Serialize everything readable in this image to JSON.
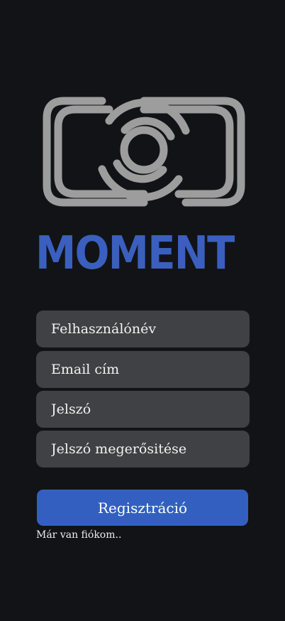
{
  "brand": {
    "title": "MOMENT",
    "logo_icon": "camera-lens-icon",
    "accent_color": "#3a5fbf"
  },
  "form": {
    "username_placeholder": "Felhasználónév",
    "email_placeholder": "Email cím",
    "password_placeholder": "Jelszó",
    "confirm_password_placeholder": "Jelszó megerősitése",
    "submit_label": "Regisztráció",
    "login_link": "Már van fiókom.."
  }
}
